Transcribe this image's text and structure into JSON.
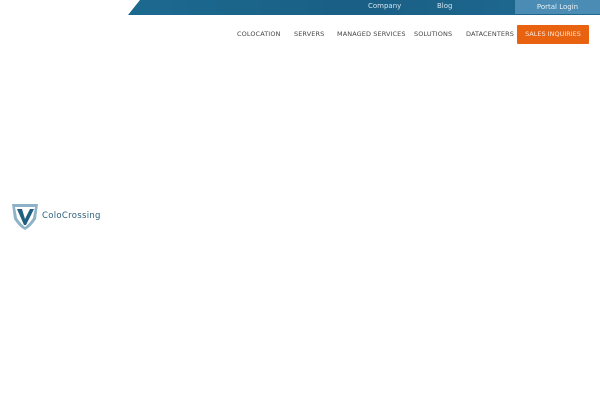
{
  "topbar": {
    "links": [
      "Company",
      "Blog"
    ],
    "portal_login": "Portal Login"
  },
  "nav": {
    "items": [
      "COLOCATION",
      "SERVERS",
      "MANAGED SERVICES",
      "SOLUTIONS",
      "DATACENTERS"
    ],
    "cta": "SALES INQUIRIES"
  },
  "logo": {
    "text": "ColoCrossing"
  },
  "colors": {
    "topbar": "#1a5f85",
    "cta": "#e8620f"
  }
}
